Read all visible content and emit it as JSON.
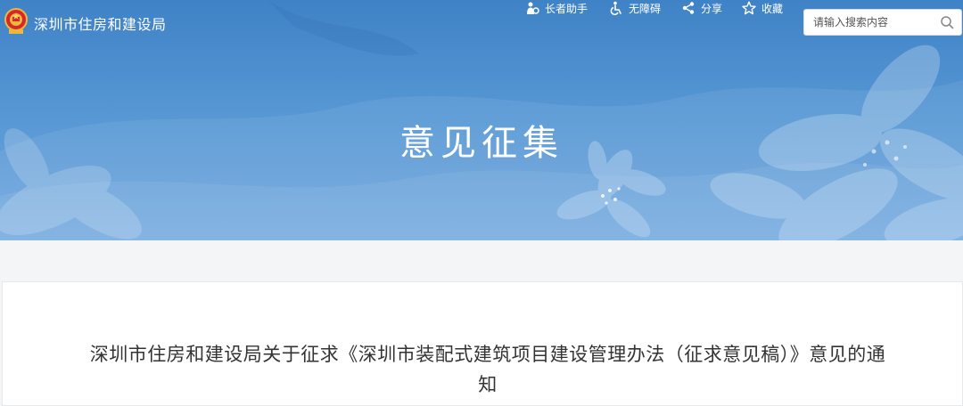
{
  "header": {
    "site_name": "深圳市住房和建设局",
    "tools": [
      {
        "label": "长者助手",
        "icon": "elderly-assistant-icon"
      },
      {
        "label": "无障碍",
        "icon": "accessibility-icon"
      },
      {
        "label": "分享",
        "icon": "share-icon"
      },
      {
        "label": "收藏",
        "icon": "star-icon"
      }
    ],
    "search": {
      "placeholder": "请输入搜索内容",
      "icon": "search-icon"
    }
  },
  "banner": {
    "title": "意见征集"
  },
  "article": {
    "title": "深圳市住房和建设局关于征求《深圳市装配式建筑项目建设管理办法（征求意见稿）》意见的通知"
  },
  "colors": {
    "banner_top": "#3f82c6",
    "banner_bottom": "#73a9df",
    "page_background": "#f4f5f7",
    "title_text": "#333333"
  }
}
